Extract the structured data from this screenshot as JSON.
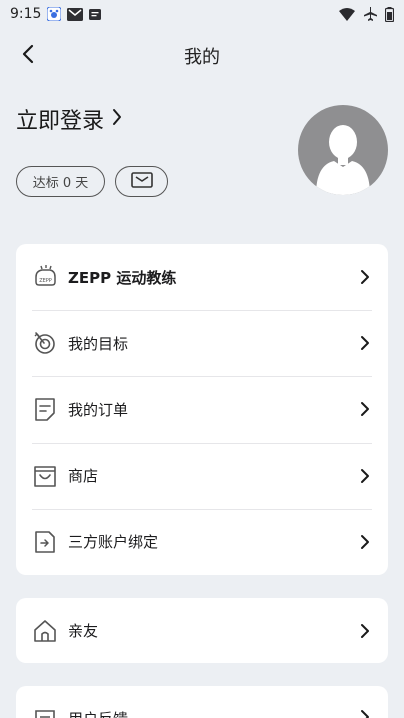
{
  "status_bar": {
    "time": "9:15",
    "left_icons": [
      "baidu-app-icon",
      "gmail-icon",
      "message-icon"
    ],
    "right_icons": [
      "wifi-icon",
      "airplane-mode-icon",
      "battery-icon"
    ]
  },
  "nav": {
    "title": "我的",
    "back_icon": "chevron-left-icon"
  },
  "profile": {
    "login_label": "立即登录",
    "goal_badge": "达标 0 天",
    "avatar_icon": "default-avatar-icon",
    "mail_icon": "mail-icon"
  },
  "menu": {
    "items": [
      {
        "label": "ZEPP 运动教练",
        "icon": "zepp-coach-icon"
      },
      {
        "label": "我的目标",
        "icon": "target-icon"
      },
      {
        "label": "我的订单",
        "icon": "order-icon"
      },
      {
        "label": "商店",
        "icon": "shop-bag-icon"
      },
      {
        "label": "三方账户绑定",
        "icon": "account-binding-icon"
      }
    ]
  },
  "family": {
    "label": "亲友",
    "icon": "home-icon"
  },
  "feedback": {
    "label": "用户反馈",
    "icon": "feedback-icon"
  },
  "colors": {
    "background": "#eceff3",
    "card": "#ffffff",
    "avatar": "#8f8f91",
    "text": "#1c1c1e"
  }
}
